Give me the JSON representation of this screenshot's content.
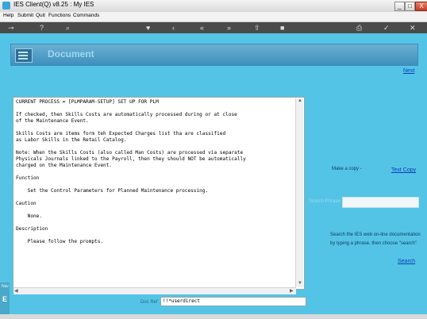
{
  "window": {
    "title": "IES Client(Q) v8.25 : My IES",
    "minimize": "_",
    "maximize": "□",
    "close": "X"
  },
  "menu": {
    "items": [
      "Help",
      "Submit",
      "Quit",
      "Functions",
      "Commands"
    ]
  },
  "toolbar": {
    "icons": [
      "key-icon",
      "help-icon",
      "search-icon",
      "heart-icon",
      "left-icon",
      "back-icon",
      "forward-icon",
      "up-icon",
      "stop-icon",
      "print-icon",
      "ok-icon",
      "close-icon"
    ]
  },
  "header": {
    "title": "Document"
  },
  "nav": {
    "next": "Next"
  },
  "document": {
    "lines": [
      "CURRENT PROCESS = [PLMPARAM-SETUP] SET UP FOR PLM",
      "",
      "If checked, then Skills Costs are automatically processed during or at close",
      "of the Maintenance Event.",
      "",
      "Skills Costs are items form teh Expected Charges list tha are classified",
      "as Labor Skills in the Retail Catalog.",
      "",
      "Note: When the Skills Costs (also called Man Costs) are processed via separate",
      "Physicals Journals linked to the Payroll, then they should NOT be automatically",
      "charged on the Maintenance Event.",
      "",
      "Function",
      "",
      "    Set the Control Parameters for Planned Maintenance processing.",
      "",
      "Caution",
      "",
      "    None.",
      "",
      "Description",
      "",
      "    Please follow the prompts."
    ]
  },
  "right_panel": {
    "copy_label": "Make a copy -",
    "copy_link": "Text Copy",
    "search_phrase_label": "Search Phrase",
    "search_phrase_value": "",
    "help_line1": "Search the IES web on-line documentation",
    "help_line2": "by typing a phrase, then choose \"search\".",
    "search_link": "Search"
  },
  "status": {
    "label": "Doc Ref",
    "value": "!!*userdirect"
  },
  "left_edge": {
    "glyph": "E",
    "small": "Nav"
  },
  "colors": {
    "background": "#54c4e6",
    "header": "#4d9ec8",
    "link": "#0a3fb8"
  }
}
